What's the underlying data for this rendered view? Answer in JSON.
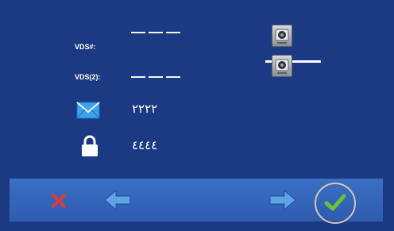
{
  "rows": {
    "vds1": {
      "label": "VDS#:",
      "value": "———"
    },
    "vds2": {
      "label": "VDS(2):",
      "value": "———"
    },
    "message": {
      "icon": "envelope-icon",
      "value": "٢٢٢٢"
    },
    "lock": {
      "icon": "padlock-icon",
      "value": "٤٤٤٤"
    }
  },
  "right_panel": {
    "icons": [
      "camera-icon",
      "camera-icon"
    ]
  },
  "toolbar": {
    "icons": [
      "close-icon",
      "arrow-left-icon",
      "arrow-right-icon",
      "checkmark-icon"
    ]
  },
  "colors": {
    "background": "#1c3a84",
    "toolbar": "#3b6fc4",
    "close": "#e0383c",
    "confirm": "#6ac13a",
    "arrow": "#5fa2e8"
  }
}
